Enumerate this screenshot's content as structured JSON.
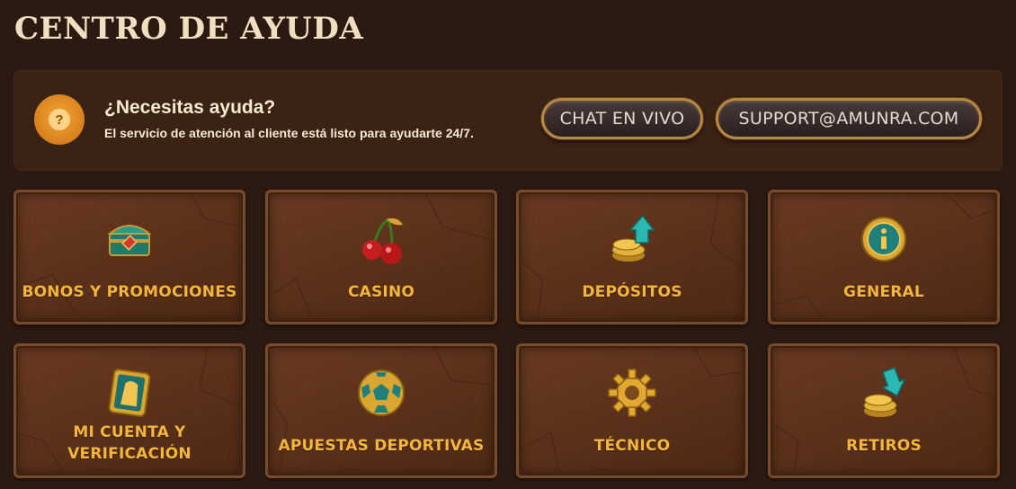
{
  "page": {
    "title": "CENTRO DE AYUDA"
  },
  "help": {
    "heading": "¿Necesitas ayuda?",
    "subtitle": "El servicio de atención al cliente está listo para ayudarte 24/7.",
    "icon": "question-icon",
    "chat_label": "CHAT EN VIVO",
    "email_label": "SUPPORT@AMUNRA.COM"
  },
  "categories": [
    {
      "label": "BONOS Y PROMOCIONES",
      "icon": "treasure-chest-icon"
    },
    {
      "label": "CASINO",
      "icon": "cherries-icon"
    },
    {
      "label": "DEPÓSITOS",
      "icon": "coins-arrow-up-icon"
    },
    {
      "label": "GENERAL",
      "icon": "info-coin-icon"
    },
    {
      "label": "MI CUENTA Y VERIFICACIÓN",
      "icon": "pharaoh-card-icon"
    },
    {
      "label": "APUESTAS DEPORTIVAS",
      "icon": "soccer-ball-icon"
    },
    {
      "label": "TÉCNICO",
      "icon": "gear-icon"
    },
    {
      "label": "RETIROS",
      "icon": "coins-arrow-down-icon"
    }
  ],
  "colors": {
    "accent": "#f4b63a",
    "card": "#5a3019",
    "background": "#2b1a12"
  }
}
